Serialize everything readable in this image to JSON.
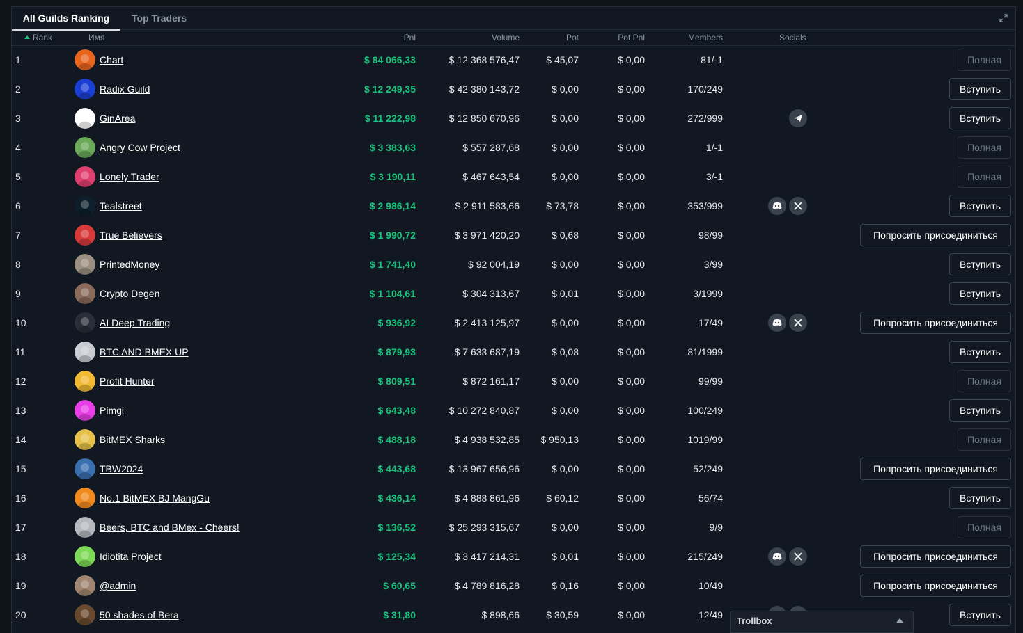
{
  "tabs": [
    {
      "label": "All Guilds Ranking"
    },
    {
      "label": "Top Traders"
    }
  ],
  "columns": {
    "rank": "Rank",
    "name": "Имя",
    "pnl": "Pnl",
    "volume": "Volume",
    "pot": "Pot",
    "pot_pnl": "Pot Pnl",
    "members": "Members",
    "socials": "Socials"
  },
  "buttons": {
    "join": "Вступить",
    "full": "Полная",
    "request": "Попросить присоединиться"
  },
  "colors": {
    "positive": "#19c37d",
    "background": "#111821"
  },
  "rows": [
    {
      "rank": "1",
      "name": "Chart",
      "pnl": "$ 84 066,33",
      "volume": "$ 12 368 576,47",
      "pot": "$ 45,07",
      "pot_pnl": "$ 0,00",
      "members": "81/-1",
      "action": "full",
      "socials": [],
      "avatar": "shrimp-avatar",
      "avcolor": "#e8651e"
    },
    {
      "rank": "2",
      "name": "Radix Guild",
      "pnl": "$ 12 249,35",
      "volume": "$ 42 380 143,72",
      "pot": "$ 0,00",
      "pot_pnl": "$ 0,00",
      "members": "170/249",
      "action": "join",
      "socials": [],
      "avatar": "radix-avatar",
      "avcolor": "#1b3fd4"
    },
    {
      "rank": "3",
      "name": "GinArea",
      "pnl": "$ 11 222,98",
      "volume": "$ 12 850 670,96",
      "pot": "$ 0,00",
      "pot_pnl": "$ 0,00",
      "members": "272/999",
      "action": "join",
      "socials": [
        "telegram"
      ],
      "avatar": "ginarea-avatar",
      "avcolor": "#ffffff"
    },
    {
      "rank": "4",
      "name": "Angry Cow Project",
      "pnl": "$ 3 383,63",
      "volume": "$ 557 287,68",
      "pot": "$ 0,00",
      "pot_pnl": "$ 0,00",
      "members": "1/-1",
      "action": "full",
      "socials": [],
      "avatar": "cow-avatar",
      "avcolor": "#6aa85a"
    },
    {
      "rank": "5",
      "name": "Lonely Trader",
      "pnl": "$ 3 190,11",
      "volume": "$ 467 643,54",
      "pot": "$ 0,00",
      "pot_pnl": "$ 0,00",
      "members": "3/-1",
      "action": "full",
      "socials": [],
      "avatar": "mushroom-avatar",
      "avcolor": "#e04070"
    },
    {
      "rank": "6",
      "name": "Tealstreet",
      "pnl": "$ 2 986,14",
      "volume": "$ 2 911 583,66",
      "pot": "$ 73,78",
      "pot_pnl": "$ 0,00",
      "members": "353/999",
      "action": "join",
      "socials": [
        "discord",
        "x"
      ],
      "avatar": "tealstreet-avatar",
      "avcolor": "#0d1f2a"
    },
    {
      "rank": "7",
      "name": "True Believers",
      "pnl": "$ 1 990,72",
      "volume": "$ 3 971 420,20",
      "pot": "$ 0,68",
      "pot_pnl": "$ 0,00",
      "members": "98/99",
      "action": "req",
      "socials": [],
      "avatar": "rocket-avatar",
      "avcolor": "#d83a3a"
    },
    {
      "rank": "8",
      "name": "PrintedMoney",
      "pnl": "$ 1 741,40",
      "volume": "$ 92 004,19",
      "pot": "$ 0,00",
      "pot_pnl": "$ 0,00",
      "members": "3/99",
      "action": "join",
      "socials": [],
      "avatar": "man-avatar",
      "avcolor": "#9a8f80"
    },
    {
      "rank": "9",
      "name": "Crypto Degen",
      "pnl": "$ 1 104,61",
      "volume": "$ 304 313,67",
      "pot": "$ 0,01",
      "pot_pnl": "$ 0,00",
      "members": "3/1999",
      "action": "join",
      "socials": [],
      "avatar": "degen-avatar",
      "avcolor": "#8a6a5a"
    },
    {
      "rank": "10",
      "name": "AI Deep Trading",
      "pnl": "$ 936,92",
      "volume": "$ 2 413 125,97",
      "pot": "$ 0,00",
      "pot_pnl": "$ 0,00",
      "members": "17/49",
      "action": "req",
      "socials": [
        "discord",
        "x"
      ],
      "avatar": "suit-avatar",
      "avcolor": "#2a2e38"
    },
    {
      "rank": "11",
      "name": "BTC AND BMEX UP",
      "pnl": "$ 879,93",
      "volume": "$ 7 633 687,19",
      "pot": "$ 0,08",
      "pot_pnl": "$ 0,00",
      "members": "81/1999",
      "action": "join",
      "socials": [],
      "avatar": "bmex-grey-avatar",
      "avcolor": "#c9cdd3"
    },
    {
      "rank": "12",
      "name": "Profit Hunter",
      "pnl": "$ 809,51",
      "volume": "$ 872 161,17",
      "pot": "$ 0,00",
      "pot_pnl": "$ 0,00",
      "members": "99/99",
      "action": "full",
      "socials": [],
      "avatar": "smile-avatar",
      "avcolor": "#f2b933"
    },
    {
      "rank": "13",
      "name": "Pimgi",
      "pnl": "$ 643,48",
      "volume": "$ 10 272 840,87",
      "pot": "$ 0,00",
      "pot_pnl": "$ 0,00",
      "members": "100/249",
      "action": "join",
      "socials": [],
      "avatar": "bitcoin-pink-avatar",
      "avcolor": "#e83ee8"
    },
    {
      "rank": "14",
      "name": "BitMEX Sharks",
      "pnl": "$ 488,18",
      "volume": "$ 4 938 532,85",
      "pot": "$ 950,13",
      "pot_pnl": "$ 0,00",
      "members": "1019/99",
      "action": "full",
      "socials": [],
      "avatar": "bmex-gold-avatar",
      "avcolor": "#e7c24a"
    },
    {
      "rank": "15",
      "name": "TBW2024",
      "pnl": "$ 443,68",
      "volume": "$ 13 967 656,96",
      "pot": "$ 0,00",
      "pot_pnl": "$ 0,00",
      "members": "52/249",
      "action": "req",
      "socials": [],
      "avatar": "cartoon-avatar",
      "avcolor": "#3a6fb0"
    },
    {
      "rank": "16",
      "name": "No.1 BitMEX BJ MangGu",
      "pnl": "$ 436,14",
      "volume": "$ 4 888 861,96",
      "pot": "$ 60,12",
      "pot_pnl": "$ 0,00",
      "members": "56/74",
      "action": "join",
      "socials": [],
      "avatar": "orange-face-avatar",
      "avcolor": "#f08a1e"
    },
    {
      "rank": "17",
      "name": "Beers, BTC and BMex - Cheers!",
      "pnl": "$ 136,52",
      "volume": "$ 25 293 315,67",
      "pot": "$ 0,00",
      "pot_pnl": "$ 0,00",
      "members": "9/9",
      "action": "full",
      "socials": [],
      "avatar": "pepe-grey-avatar",
      "avcolor": "#b5b9bf"
    },
    {
      "rank": "18",
      "name": "Idiotita Project",
      "pnl": "$ 125,34",
      "volume": "$ 3 417 214,31",
      "pot": "$ 0,01",
      "pot_pnl": "$ 0,00",
      "members": "215/249",
      "action": "req",
      "socials": [
        "discord",
        "x"
      ],
      "avatar": "green-face-avatar",
      "avcolor": "#7ed957"
    },
    {
      "rank": "19",
      "name": "@admin",
      "pnl": "$ 60,65",
      "volume": "$ 4 789 816,28",
      "pot": "$ 0,16",
      "pot_pnl": "$ 0,00",
      "members": "10/49",
      "action": "req",
      "socials": [],
      "avatar": "cat-avatar",
      "avcolor": "#a08670"
    },
    {
      "rank": "20",
      "name": "50 shades of Bera",
      "pnl": "$ 31,80",
      "volume": "$ 898,66",
      "pot": "$ 30,59",
      "pot_pnl": "$ 0,00",
      "members": "12/49",
      "action": "join",
      "socials": [
        "discord",
        "x"
      ],
      "avatar": "bear-avatar",
      "avcolor": "#6a4a2e"
    }
  ],
  "trollbox": {
    "label": "Trollbox"
  }
}
